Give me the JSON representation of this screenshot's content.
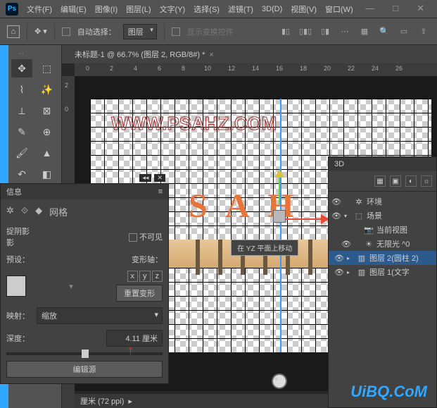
{
  "menu": {
    "file": "文件(F)",
    "edit": "编辑(E)",
    "image": "图像(I)",
    "layer": "图层(L)",
    "type": "文字(Y)",
    "select": "选择(S)",
    "filter": "滤镜(T)",
    "threed": "3D(D)",
    "view": "视图(V)",
    "window": "窗口(W)"
  },
  "optbar": {
    "autoselect": "自动选择：",
    "layerdd": "图层",
    "showtransform": "显示变换控件"
  },
  "tab": {
    "title": "未标题-1 @ 66.7% (图层 2, RGB/8#) *"
  },
  "ruler": {
    "h": [
      "0",
      "2",
      "4",
      "6",
      "8",
      "10",
      "12",
      "14",
      "16",
      "18",
      "20",
      "22",
      "24",
      "26"
    ],
    "v": [
      "2",
      "0"
    ]
  },
  "canvas": {
    "watermark": "WWW.PSAHZ.COM",
    "text3d": "S A H",
    "tooltip": "在 YZ 平面上移动"
  },
  "status": {
    "text": "厘米 (72 ppi)"
  },
  "info": {
    "title": "信息",
    "grid": "网格",
    "shadow": "捉阴影",
    "shadow2": "影",
    "invisible": "不可见",
    "preset": "预设：",
    "deform_axis": "变形轴：",
    "reset": "重置变形",
    "mapping": "映射：",
    "mapping_val": "缩放",
    "depth": "深度：",
    "depth_val": "4.11 厘米",
    "editsrc": "编辑源"
  },
  "panel3d": {
    "tab": "3D",
    "env": "环境",
    "scene": "场景",
    "curview": "当前视图",
    "infinite": "无限光 ^0",
    "layer2": "图层 2(圆柱 2)",
    "layer1": "图层 1(文字"
  },
  "brand": "UiBQ.CoM"
}
